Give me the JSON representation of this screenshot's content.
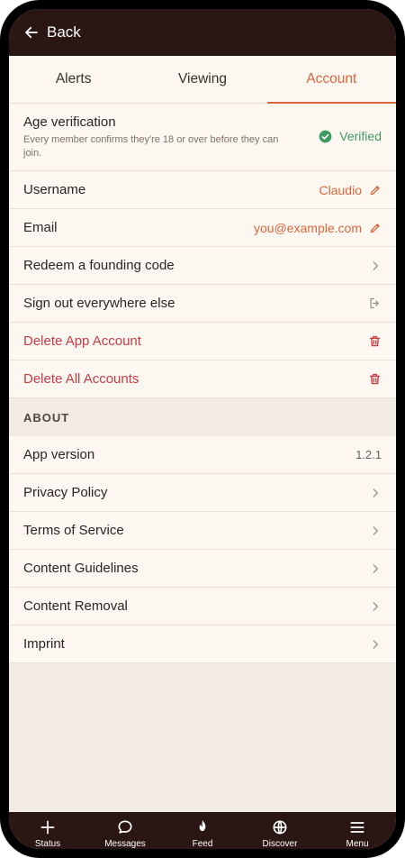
{
  "header": {
    "back_label": "Back"
  },
  "tabs": [
    {
      "label": "Alerts"
    },
    {
      "label": "Viewing"
    },
    {
      "label": "Account",
      "active": true
    }
  ],
  "account": {
    "age_verification": {
      "title": "Age verification",
      "subtitle": "Every member confirms they're 18 or over before they can join.",
      "status": "Verified"
    },
    "username": {
      "label": "Username",
      "value": "Claudio"
    },
    "email": {
      "label": "Email",
      "value": "you@example.com"
    },
    "redeem": {
      "label": "Redeem a founding code"
    },
    "signout": {
      "label": "Sign out everywhere else"
    },
    "delete_app": {
      "label": "Delete App Account"
    },
    "delete_all": {
      "label": "Delete All Accounts"
    }
  },
  "about": {
    "title": "ABOUT",
    "app_version": {
      "label": "App version",
      "value": "1.2.1"
    },
    "items": [
      {
        "label": "Privacy Policy"
      },
      {
        "label": "Terms of Service"
      },
      {
        "label": "Content Guidelines"
      },
      {
        "label": "Content Removal"
      },
      {
        "label": "Imprint"
      }
    ]
  },
  "bottom_nav": [
    {
      "label": "Status",
      "icon": "plus-icon"
    },
    {
      "label": "Messages",
      "icon": "chat-icon"
    },
    {
      "label": "Feed",
      "icon": "flame-icon"
    },
    {
      "label": "Discover",
      "icon": "globe-icon"
    },
    {
      "label": "Menu",
      "icon": "menu-icon"
    }
  ],
  "colors": {
    "accent": "#d9683d",
    "danger": "#c73d44",
    "success": "#3f9a62",
    "dark_bar": "#2a1613",
    "surface": "#fdf7f1"
  }
}
